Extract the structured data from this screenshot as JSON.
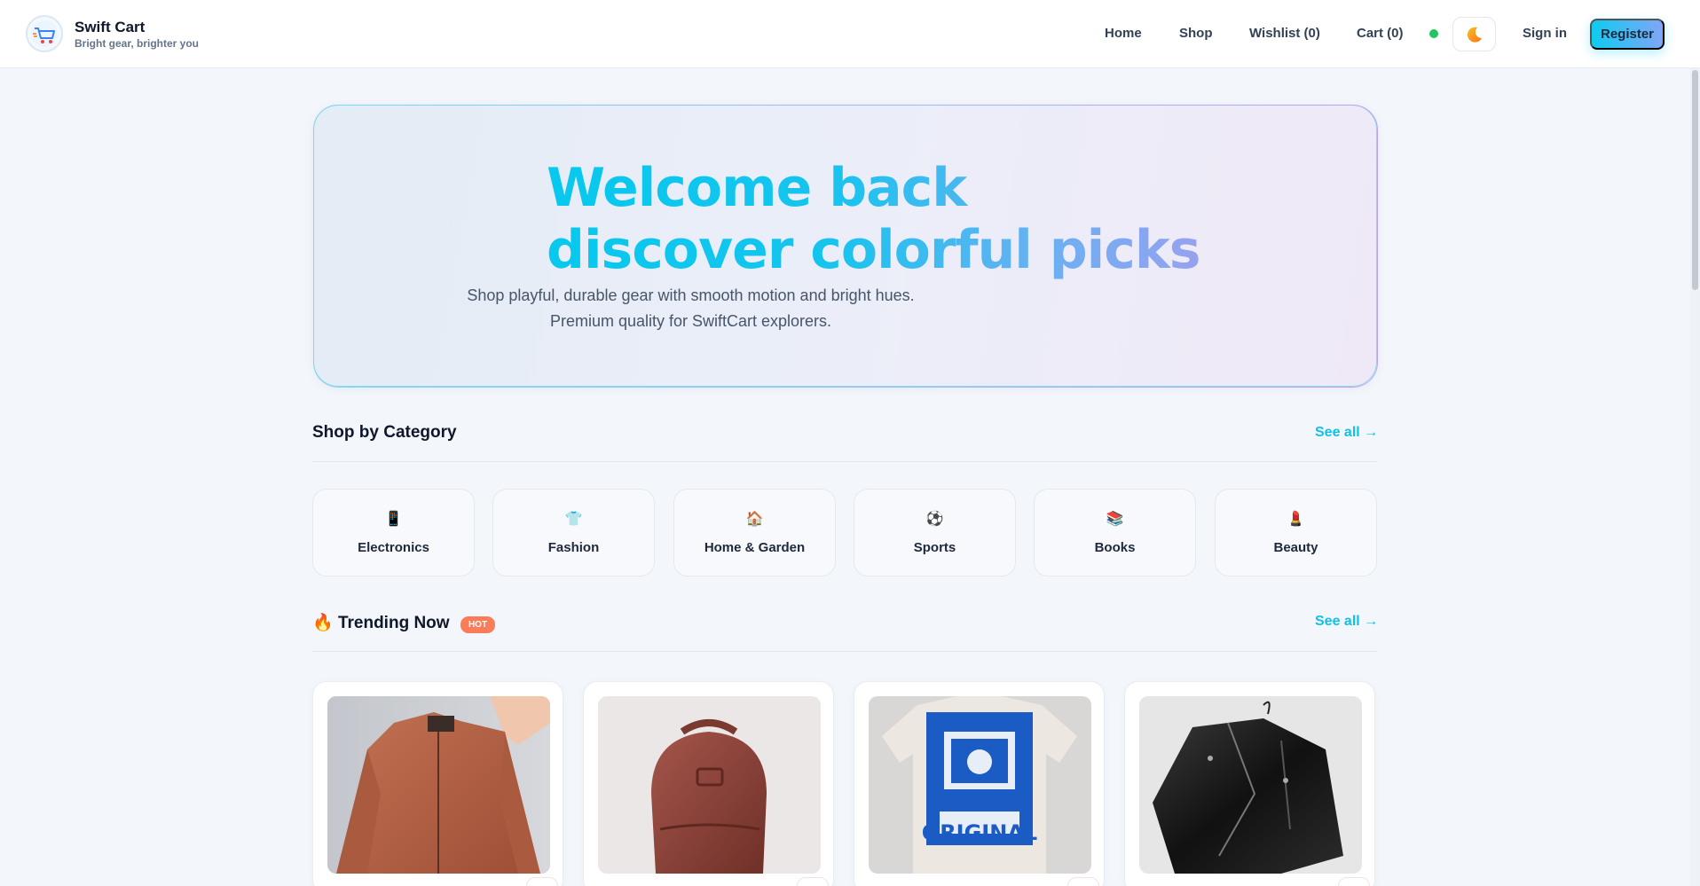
{
  "header": {
    "brand_name": "Swift Cart",
    "brand_tagline": "Bright gear, brighter you",
    "nav": {
      "home": "Home",
      "shop": "Shop",
      "wishlist": "Wishlist (0)",
      "cart": "Cart (0)"
    },
    "theme_icon": "moon-icon",
    "sign_in": "Sign in",
    "register": "Register"
  },
  "hero": {
    "title_line1": "Welcome back",
    "title_line2": "discover colorful picks",
    "subtitle_line1": "Shop playful, durable gear with smooth motion and bright hues.",
    "subtitle_line2": "Premium quality for SwiftCart explorers."
  },
  "categories": {
    "title": "Shop by Category",
    "see_all": "See all →",
    "items": [
      {
        "label": "Electronics",
        "icon": "📱"
      },
      {
        "label": "Fashion",
        "icon": "👕"
      },
      {
        "label": "Home & Garden",
        "icon": "🏠"
      },
      {
        "label": "Sports",
        "icon": "⚽"
      },
      {
        "label": "Books",
        "icon": "📚"
      },
      {
        "label": "Beauty",
        "icon": "💄"
      }
    ]
  },
  "trending": {
    "icon": "🔥",
    "title": "Trending Now",
    "badge": "HOT",
    "see_all": "See all →",
    "products": [
      {
        "image": "orange-bomber-jacket"
      },
      {
        "image": "brown-leather-backpack"
      },
      {
        "image": "original-cat-tshirt",
        "print_text": "ORIGINAL"
      },
      {
        "image": "black-leather-jacket"
      }
    ]
  },
  "colors": {
    "accent": "#0ecbf0",
    "accent_end": "#a89cef",
    "hot": "#fb7c5a",
    "online": "#22c55e"
  }
}
